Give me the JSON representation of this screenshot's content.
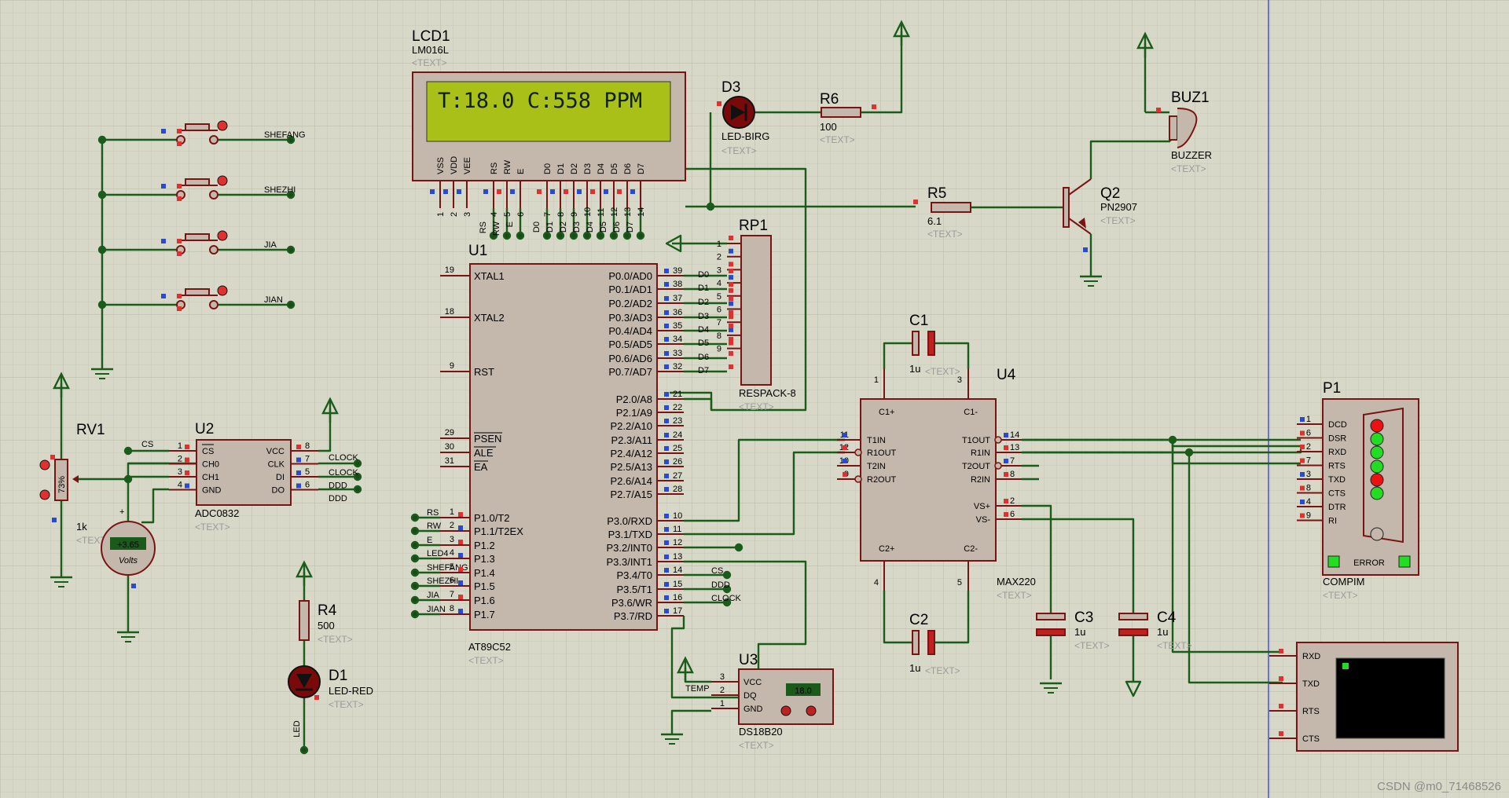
{
  "colors": {
    "background": "#d8d8c8",
    "wire": "#1a5c1a",
    "body": "#c4b8ac",
    "outline": "#7a1414",
    "lcd": "#a8c018",
    "pin_red": "#e03030",
    "pin_blue": "#2a4ad0",
    "led_green": "#22dd22",
    "led_red": "#ee1111",
    "meter": "#1a5a1a",
    "ruler": "#2233cc"
  },
  "placeholder": "<TEXT>",
  "lcd": {
    "ref": "LCD1",
    "part": "LM016L",
    "display": "T:18.0 C:558 PPM",
    "pins": [
      "VSS",
      "VDD",
      "VEE",
      "RS",
      "RW",
      "E",
      "D0",
      "D1",
      "D2",
      "D3",
      "D4",
      "D5",
      "D6",
      "D7"
    ],
    "nums": [
      "1",
      "2",
      "3",
      "4",
      "5",
      "6",
      "7",
      "8",
      "9",
      "10",
      "11",
      "12",
      "13",
      "14"
    ],
    "nets": [
      "RS",
      "RW",
      "E",
      "D0",
      "D1",
      "D2",
      "D3",
      "D4",
      "D5",
      "D6",
      "D7"
    ]
  },
  "mcu": {
    "ref": "U1",
    "part": "AT89C52",
    "left_pins": [
      {
        "num": "19",
        "name": "XTAL1"
      },
      {
        "num": "18",
        "name": "XTAL2"
      },
      {
        "num": "9",
        "name": "RST"
      },
      {
        "num": "29",
        "name": "PSEN"
      },
      {
        "num": "30",
        "name": "ALE"
      },
      {
        "num": "31",
        "name": "EA"
      },
      {
        "num": "1",
        "name": "P1.0/T2"
      },
      {
        "num": "2",
        "name": "P1.1/T2EX"
      },
      {
        "num": "3",
        "name": "P1.2"
      },
      {
        "num": "4",
        "name": "P1.3"
      },
      {
        "num": "5",
        "name": "P1.4"
      },
      {
        "num": "6",
        "name": "P1.5"
      },
      {
        "num": "7",
        "name": "P1.6"
      },
      {
        "num": "8",
        "name": "P1.7"
      }
    ],
    "left_nets": [
      "RS",
      "RW",
      "E",
      "LED4",
      "SHEFANG",
      "SHEZHI",
      "JIA",
      "JIAN"
    ],
    "right_pins": [
      {
        "num": "39",
        "name": "P0.0/AD0"
      },
      {
        "num": "38",
        "name": "P0.1/AD1"
      },
      {
        "num": "37",
        "name": "P0.2/AD2"
      },
      {
        "num": "36",
        "name": "P0.3/AD3"
      },
      {
        "num": "35",
        "name": "P0.4/AD4"
      },
      {
        "num": "34",
        "name": "P0.5/AD5"
      },
      {
        "num": "33",
        "name": "P0.6/AD6"
      },
      {
        "num": "32",
        "name": "P0.7/AD7"
      },
      {
        "num": "21",
        "name": "P2.0/A8"
      },
      {
        "num": "22",
        "name": "P2.1/A9"
      },
      {
        "num": "23",
        "name": "P2.2/A10"
      },
      {
        "num": "24",
        "name": "P2.3/A11"
      },
      {
        "num": "25",
        "name": "P2.4/A12"
      },
      {
        "num": "26",
        "name": "P2.5/A13"
      },
      {
        "num": "27",
        "name": "P2.6/A14"
      },
      {
        "num": "28",
        "name": "P2.7/A15"
      },
      {
        "num": "10",
        "name": "P3.0/RXD"
      },
      {
        "num": "11",
        "name": "P3.1/TXD"
      },
      {
        "num": "12",
        "name": "P3.2/INT0"
      },
      {
        "num": "13",
        "name": "P3.3/INT1"
      },
      {
        "num": "14",
        "name": "P3.4/T0"
      },
      {
        "num": "15",
        "name": "P3.5/T1"
      },
      {
        "num": "16",
        "name": "P3.6/WR"
      },
      {
        "num": "17",
        "name": "P3.7/RD"
      }
    ],
    "p0_nets": [
      "D0",
      "D1",
      "D2",
      "D3",
      "D4",
      "D5",
      "D6",
      "D7"
    ],
    "p3_nets": [
      "CS",
      "DDD",
      "CLOCK"
    ]
  },
  "rp1": {
    "ref": "RP1",
    "part": "RESPACK-8",
    "pins": [
      "1",
      "2",
      "3",
      "4",
      "5",
      "6",
      "7",
      "8",
      "9"
    ]
  },
  "d3": {
    "ref": "D3",
    "part": "LED-BIRG"
  },
  "r6": {
    "ref": "R6",
    "value": "100"
  },
  "r5": {
    "ref": "R5",
    "value": "6.1"
  },
  "buz": {
    "ref": "BUZ1",
    "part": "BUZZER"
  },
  "q2": {
    "ref": "Q2",
    "part": "PN2907"
  },
  "buttons": [
    {
      "label": "SHEFANG"
    },
    {
      "label": "SHEZHI"
    },
    {
      "label": "JIA"
    },
    {
      "label": "JIAN"
    }
  ],
  "rv1": {
    "ref": "RV1",
    "value": "1k",
    "percent": "73%"
  },
  "voltmeter": {
    "reading": "+3.65",
    "unit": "Volts"
  },
  "adc": {
    "ref": "U2",
    "part": "ADC0832",
    "left": [
      {
        "num": "1",
        "name": "CS"
      },
      {
        "num": "2",
        "name": "CH0"
      },
      {
        "num": "3",
        "name": "CH1"
      },
      {
        "num": "4",
        "name": "GND"
      }
    ],
    "right": [
      {
        "num": "8",
        "name": "VCC"
      },
      {
        "num": "7",
        "name": "CLK"
      },
      {
        "num": "5",
        "name": "DI"
      },
      {
        "num": "6",
        "name": "DO"
      }
    ],
    "nets": [
      "CS",
      "CLOCK",
      "DDD",
      "DDD"
    ]
  },
  "r4": {
    "ref": "R4",
    "value": "500"
  },
  "d1": {
    "ref": "D1",
    "part": "LED-RED",
    "net": "LED"
  },
  "ds": {
    "ref": "U3",
    "part": "DS18B20",
    "pins": [
      {
        "num": "3",
        "name": "VCC"
      },
      {
        "num": "2",
        "name": "DQ"
      },
      {
        "num": "1",
        "name": "GND"
      }
    ],
    "net": "TEMP",
    "reading": "18.0"
  },
  "max": {
    "ref": "U4",
    "part": "MAX220",
    "left": [
      {
        "num": "11",
        "name": "T1IN"
      },
      {
        "num": "12",
        "name": "R1OUT"
      },
      {
        "num": "10",
        "name": "T2IN"
      },
      {
        "num": "9",
        "name": "R2OUT"
      }
    ],
    "right": [
      {
        "num": "14",
        "name": "T1OUT"
      },
      {
        "num": "13",
        "name": "R1IN"
      },
      {
        "num": "7",
        "name": "T2OUT"
      },
      {
        "num": "8",
        "name": "R2IN"
      },
      {
        "num": "2",
        "name": "VS+"
      },
      {
        "num": "6",
        "name": "VS-"
      }
    ],
    "top": [
      "C1+",
      "C1-"
    ],
    "bottom": [
      "C2+",
      "C2-"
    ],
    "top_nums": [
      "1",
      "3"
    ],
    "bottom_nums": [
      "4",
      "5"
    ]
  },
  "caps": [
    {
      "ref": "C1",
      "value": "1u"
    },
    {
      "ref": "C2",
      "value": "1u"
    },
    {
      "ref": "C3",
      "value": "1u"
    },
    {
      "ref": "C4",
      "value": "1u"
    }
  ],
  "p1": {
    "ref": "P1",
    "part": "COMPIM",
    "pins": [
      {
        "num": "1",
        "name": "DCD"
      },
      {
        "num": "6",
        "name": "DSR"
      },
      {
        "num": "2",
        "name": "RXD"
      },
      {
        "num": "7",
        "name": "RTS"
      },
      {
        "num": "3",
        "name": "TXD"
      },
      {
        "num": "8",
        "name": "CTS"
      },
      {
        "num": "4",
        "name": "DTR"
      },
      {
        "num": "9",
        "name": "RI"
      }
    ],
    "error": "ERROR",
    "leds": [
      "red",
      "green",
      "green",
      "green",
      "red",
      "green",
      "off"
    ]
  },
  "vt": {
    "pins": [
      "RXD",
      "TXD",
      "RTS",
      "CTS"
    ]
  },
  "watermark": "CSDN @m0_71468526"
}
